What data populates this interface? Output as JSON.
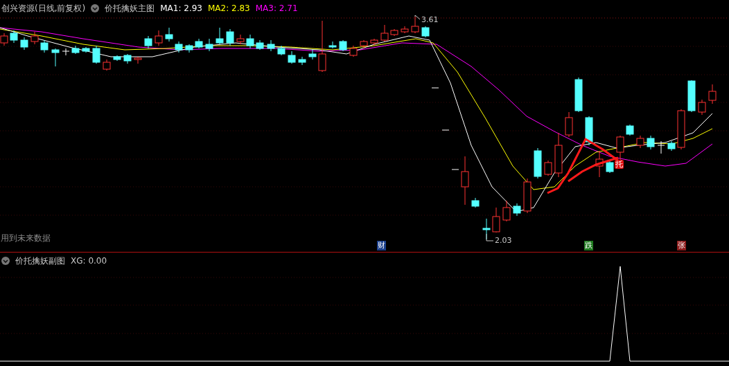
{
  "main_chart": {
    "title": "创兴资源(日线,前复权)",
    "indicator": "价托擒妖主图",
    "moving_averages": [
      {
        "label": "MA1: 2.93",
        "color": "#ffffff"
      },
      {
        "label": "MA2: 2.83",
        "color": "#ffff00"
      },
      {
        "label": "MA3: 2.71",
        "color": "#ff00ff"
      }
    ],
    "high_label": "3.61",
    "low_label": "2.03",
    "signal": "托",
    "note": "用到未来数据",
    "badges": [
      {
        "text": "财",
        "color": "#1a3f8c"
      },
      {
        "text": "跌",
        "color": "#1f7a1f"
      },
      {
        "text": "张",
        "color": "#8c1a1a"
      }
    ]
  },
  "sub_chart": {
    "title": "价托擒妖副图",
    "reading": "XG: 0.00"
  }
}
